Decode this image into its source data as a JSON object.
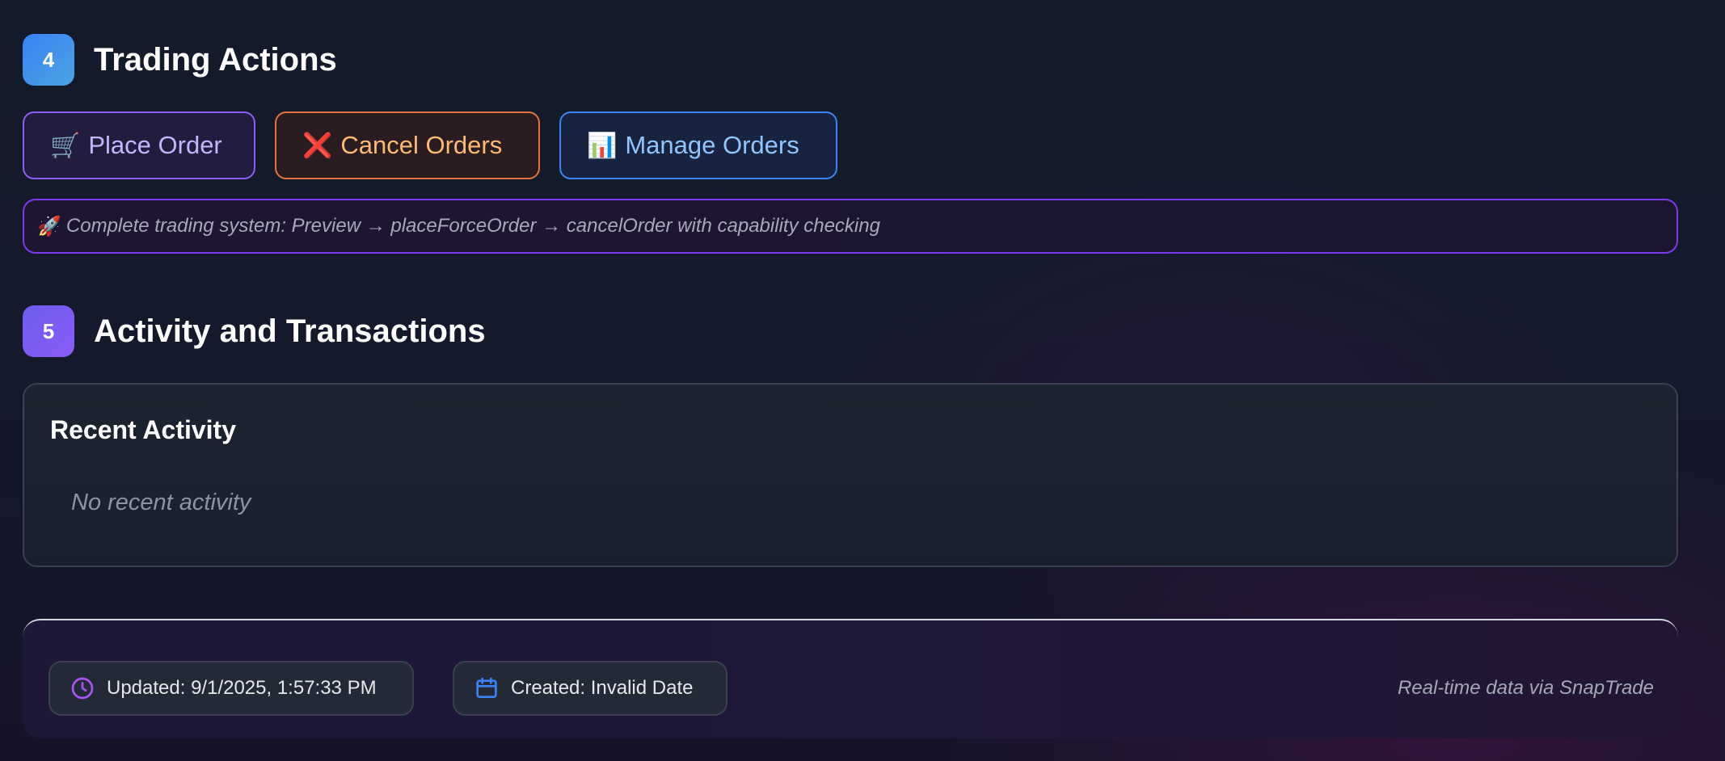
{
  "sections": [
    {
      "number": "4",
      "title": "Trading Actions"
    },
    {
      "number": "5",
      "title": "Activity and Transactions"
    }
  ],
  "actions": {
    "place": {
      "emoji": "🛒",
      "label": "Place Order"
    },
    "cancel": {
      "emoji": "❌",
      "label": "Cancel Orders"
    },
    "manage": {
      "emoji": "📊",
      "label": "Manage Orders"
    }
  },
  "note": {
    "emoji": "🚀",
    "text": "Complete trading system: Preview → placeForceOrder → cancelOrder with capability checking"
  },
  "activity": {
    "title": "Recent Activity",
    "empty_text": "No recent activity"
  },
  "footer": {
    "updated": "Updated: 9/1/2025, 1:57:33 PM",
    "created": "Created: Invalid Date",
    "source_note": "Real-time data via SnapTrade",
    "updated_icon": "clock-icon",
    "created_icon": "calendar-icon"
  },
  "colors": {
    "accent_purple": "#8b5cf6",
    "accent_orange": "#e2743c",
    "accent_blue": "#3b82f6"
  }
}
